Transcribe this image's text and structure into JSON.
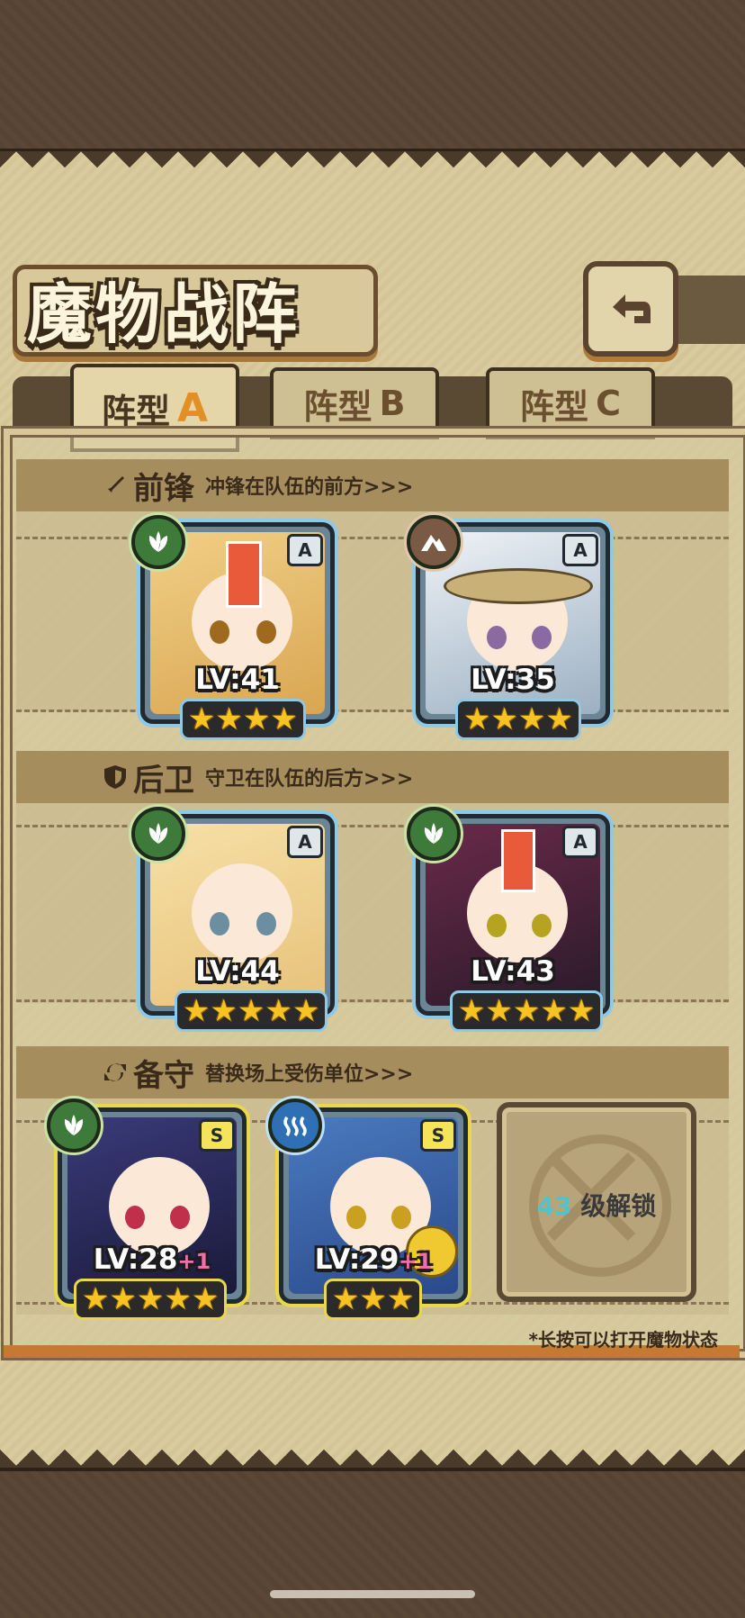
{
  "title": "魔物战阵",
  "tabs": [
    {
      "label": "阵型",
      "letter": "A",
      "active": true
    },
    {
      "label": "阵型",
      "letter": "B",
      "active": false
    },
    {
      "label": "阵型",
      "letter": "C",
      "active": false
    }
  ],
  "sections": {
    "front": {
      "title": "前锋",
      "desc": "冲锋在队伍的前方>>>",
      "icon": "sword-icon"
    },
    "back": {
      "title": "后卫",
      "desc": "守卫在队伍的后方>>>",
      "icon": "shield-icon"
    },
    "reserve": {
      "title": "备守",
      "desc": "替换场上受伤单位>>>",
      "icon": "swap-icon"
    }
  },
  "cards": [
    {
      "level": "LV:41",
      "plus": "",
      "rank": "A",
      "stars": 4,
      "element": "leaf-icon"
    },
    {
      "level": "LV:35",
      "plus": "",
      "rank": "A",
      "stars": 4,
      "element": "rock-icon"
    },
    {
      "level": "LV:44",
      "plus": "",
      "rank": "A",
      "stars": 5,
      "element": "leaf-icon"
    },
    {
      "level": "LV:43",
      "plus": "",
      "rank": "A",
      "stars": 5,
      "element": "leaf-icon"
    },
    {
      "level": "LV:28",
      "plus": "+1",
      "rank": "S",
      "stars": 5,
      "element": "leaf-icon"
    },
    {
      "level": "LV:29",
      "plus": "+1",
      "rank": "S",
      "stars": 3,
      "element": "water-icon"
    }
  ],
  "locked_slot": {
    "level": "43",
    "text": "级解锁"
  },
  "hint": "*长按可以打开魔物状态",
  "colors": {
    "accent": "#e28f25",
    "gold_frame": "#e8d84a",
    "blue_frame": "#8ec9e8",
    "star": "#f7c322"
  }
}
